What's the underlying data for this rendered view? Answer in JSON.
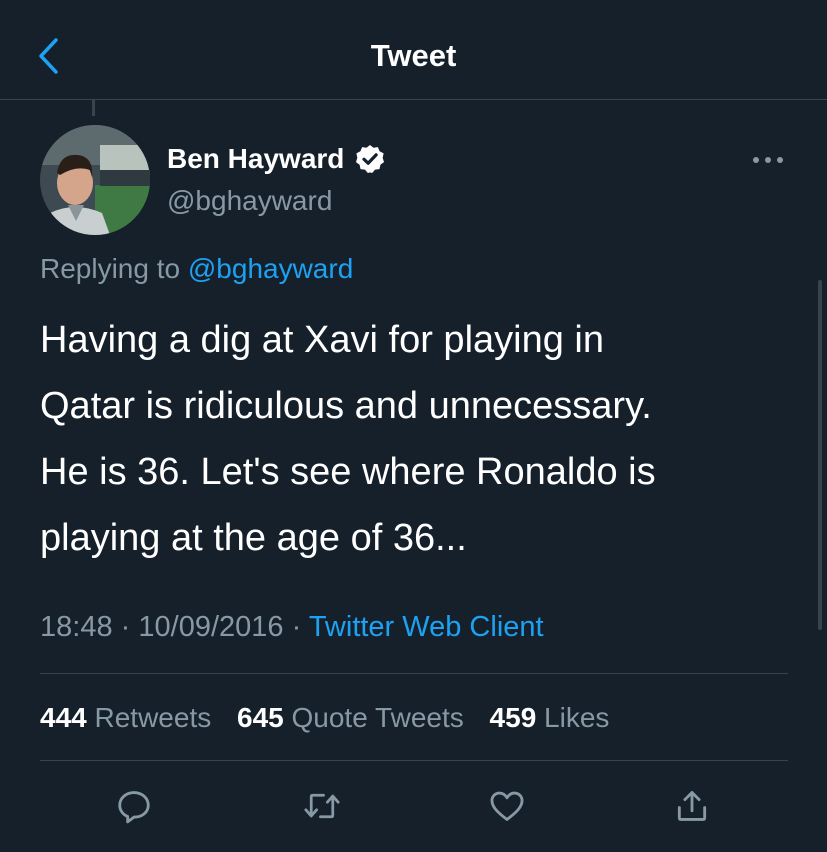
{
  "header": {
    "title": "Tweet",
    "back_icon": "chevron-left-icon"
  },
  "tweet": {
    "author": {
      "name": "Ben Hayward",
      "handle": "@bghayward",
      "verified": true
    },
    "replying_prefix": "Replying to ",
    "replying_to": "@bghayward",
    "text": "Having a dig at Xavi for playing in\nQatar is ridiculous and unnecessary.\nHe is 36. Let's see where Ronaldo is\nplaying at the age of 36...",
    "time": "18:48",
    "date": "10/09/2016",
    "separator": "·",
    "source": "Twitter Web Client"
  },
  "stats": {
    "retweets_count": "444",
    "retweets_label": "Retweets",
    "quotes_count": "645",
    "quotes_label": "Quote Tweets",
    "likes_count": "459",
    "likes_label": "Likes"
  },
  "actions": [
    "reply-icon",
    "retweet-icon",
    "like-icon",
    "share-icon"
  ],
  "colors": {
    "background": "#15202b",
    "accent": "#1da1f2",
    "secondary_text": "#8899a6",
    "divider": "#38444d"
  }
}
